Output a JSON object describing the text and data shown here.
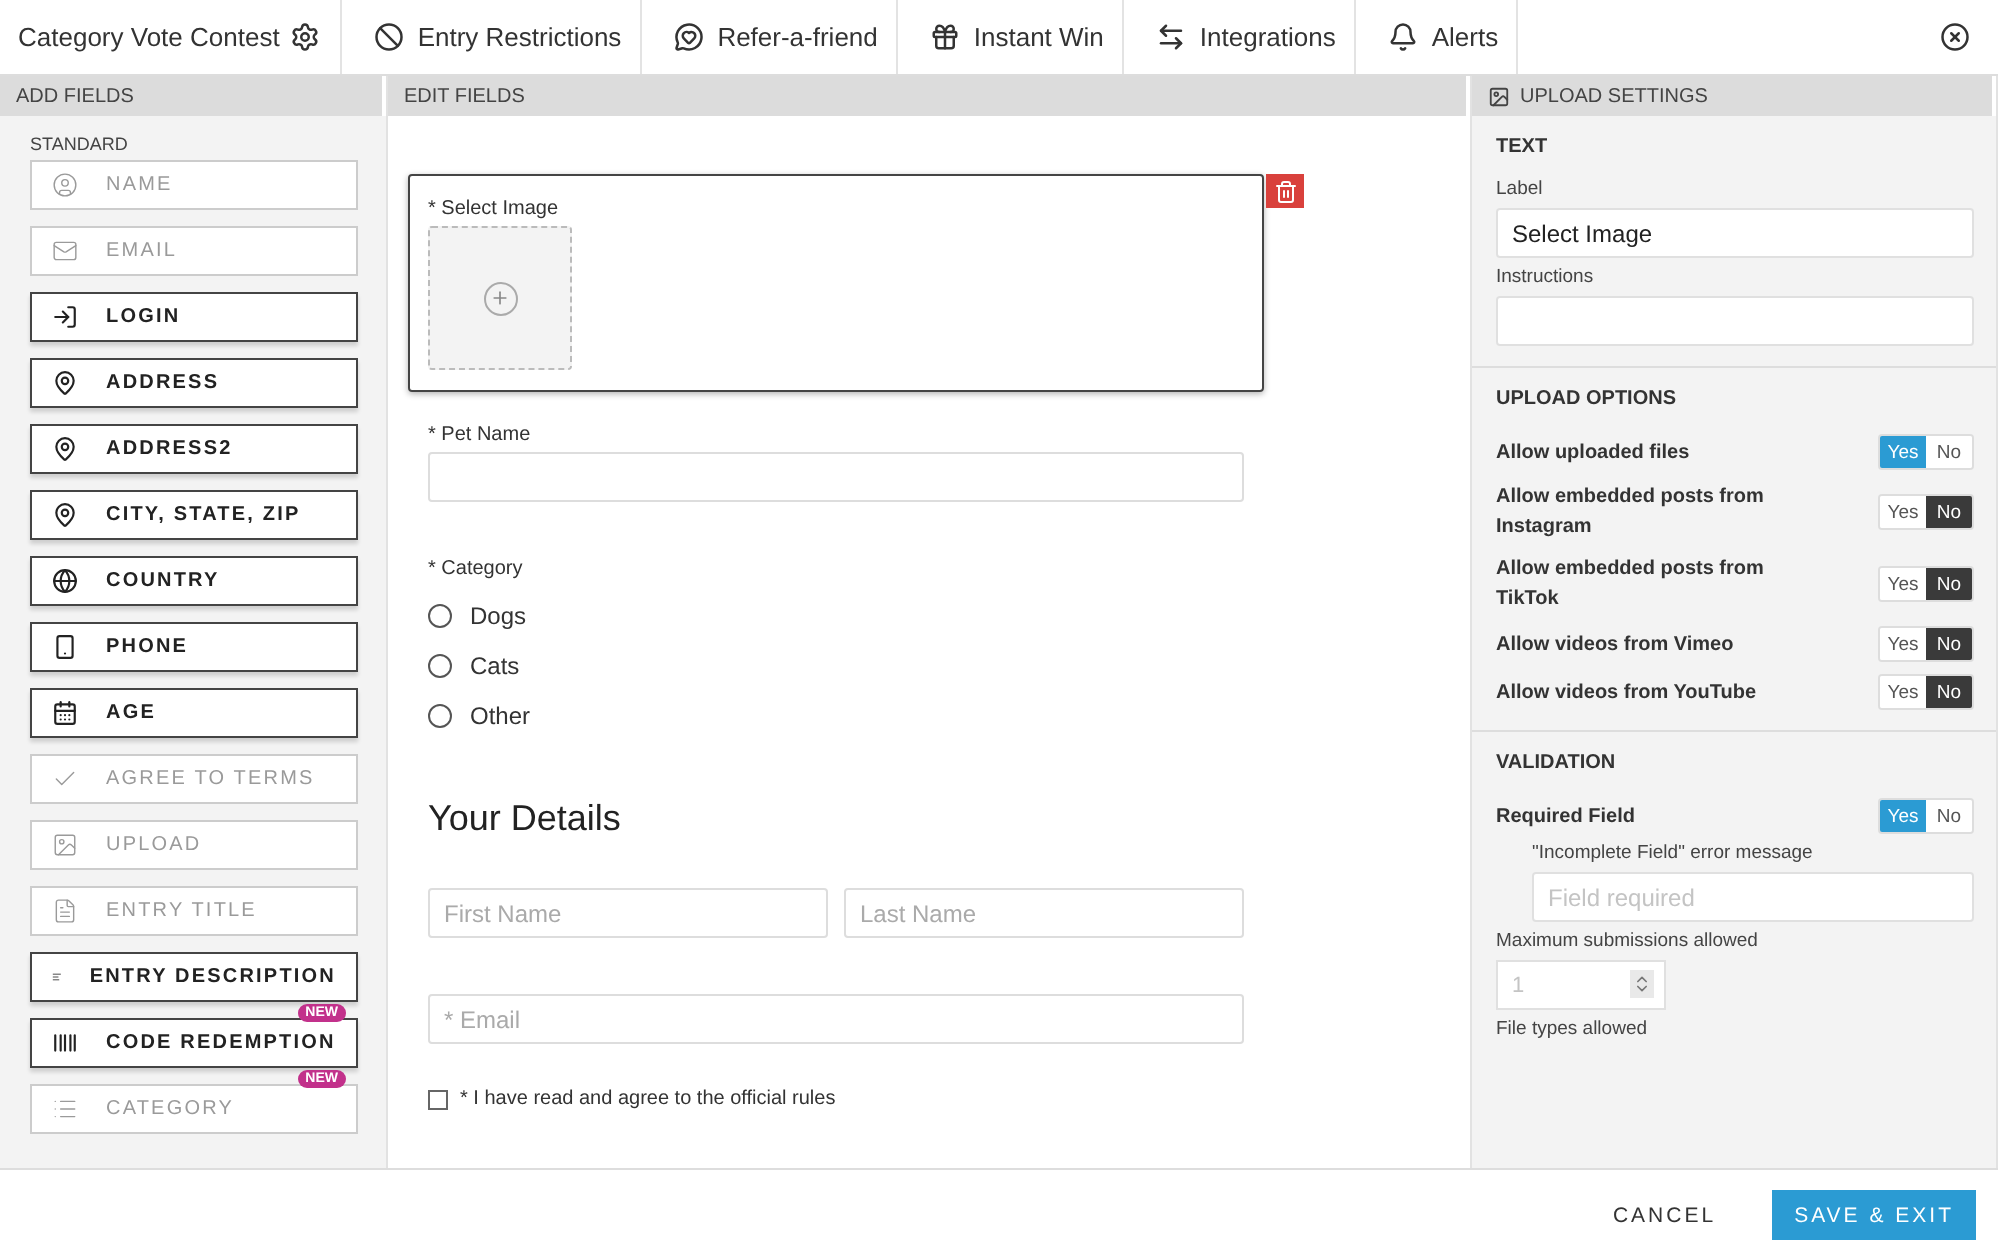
{
  "top_nav": {
    "title": "Category Vote Contest",
    "tabs": [
      {
        "label": "Entry Restrictions",
        "selected": false
      },
      {
        "label": "Refer-a-friend",
        "selected": false
      },
      {
        "label": "Instant Win",
        "selected": false
      },
      {
        "label": "Integrations",
        "selected": false
      },
      {
        "label": "Alerts",
        "selected": false
      }
    ]
  },
  "add_fields": {
    "header": "ADD FIELDS",
    "section": "STANDARD",
    "items": [
      {
        "label": "NAME",
        "disabled": true
      },
      {
        "label": "EMAIL",
        "disabled": true
      },
      {
        "label": "LOGIN",
        "disabled": false
      },
      {
        "label": "ADDRESS",
        "disabled": false
      },
      {
        "label": "ADDRESS2",
        "disabled": false
      },
      {
        "label": "CITY, STATE, ZIP",
        "disabled": false
      },
      {
        "label": "COUNTRY",
        "disabled": false
      },
      {
        "label": "PHONE",
        "disabled": false
      },
      {
        "label": "AGE",
        "disabled": false
      },
      {
        "label": "AGREE TO TERMS",
        "disabled": true
      },
      {
        "label": "UPLOAD",
        "disabled": true
      },
      {
        "label": "ENTRY TITLE",
        "disabled": true
      },
      {
        "label": "ENTRY DESCRIPTION",
        "disabled": false
      },
      {
        "label": "CODE REDEMPTION",
        "disabled": false,
        "badge": "NEW"
      },
      {
        "label": "CATEGORY",
        "disabled": true,
        "badge": "NEW"
      }
    ]
  },
  "edit_fields": {
    "header": "EDIT FIELDS",
    "select_image": {
      "label": "* Select Image",
      "selected": true
    },
    "pet_name": {
      "label": "* Pet Name"
    },
    "category": {
      "label": "* Category",
      "options": [
        {
          "label": "Dogs",
          "selected": false
        },
        {
          "label": "Cats",
          "selected": false
        },
        {
          "label": "Other",
          "selected": false
        }
      ]
    },
    "heading": "Your Details",
    "first_name": {
      "placeholder": "First Name"
    },
    "last_name": {
      "placeholder": "Last Name"
    },
    "email": {
      "placeholder": "* Email"
    },
    "agree": {
      "label": "* I have read and agree to the official rules",
      "checked": false
    }
  },
  "upload_settings": {
    "header": "UPLOAD SETTINGS",
    "text_section": {
      "title": "TEXT",
      "label_caption": "Label",
      "label_value": "Select Image",
      "instructions_caption": "Instructions"
    },
    "options_section": {
      "title": "UPLOAD OPTIONS",
      "options": [
        {
          "label": "Allow uploaded files",
          "on": true,
          "yes": "Yes",
          "no": "No"
        },
        {
          "label": "Allow embedded posts from Instagram",
          "on": false,
          "yes": "Yes",
          "no": "No"
        },
        {
          "label": "Allow embedded posts from TikTok",
          "on": false,
          "yes": "Yes",
          "no": "No"
        },
        {
          "label": "Allow videos from Vimeo",
          "on": false,
          "yes": "Yes",
          "no": "No"
        },
        {
          "label": "Allow videos from YouTube",
          "on": false,
          "yes": "Yes",
          "no": "No"
        }
      ]
    },
    "validation": {
      "title": "VALIDATION",
      "required_label": "Required Field",
      "required_on": true,
      "required_yes": "Yes",
      "required_no": "No",
      "error_caption": "\"Incomplete Field\" error message",
      "error_placeholder": "Field required",
      "max_caption": "Maximum submissions allowed",
      "max_placeholder": "1",
      "file_types_caption": "File types allowed"
    }
  },
  "footer": {
    "cancel": "CANCEL",
    "save": "SAVE & EXIT"
  }
}
